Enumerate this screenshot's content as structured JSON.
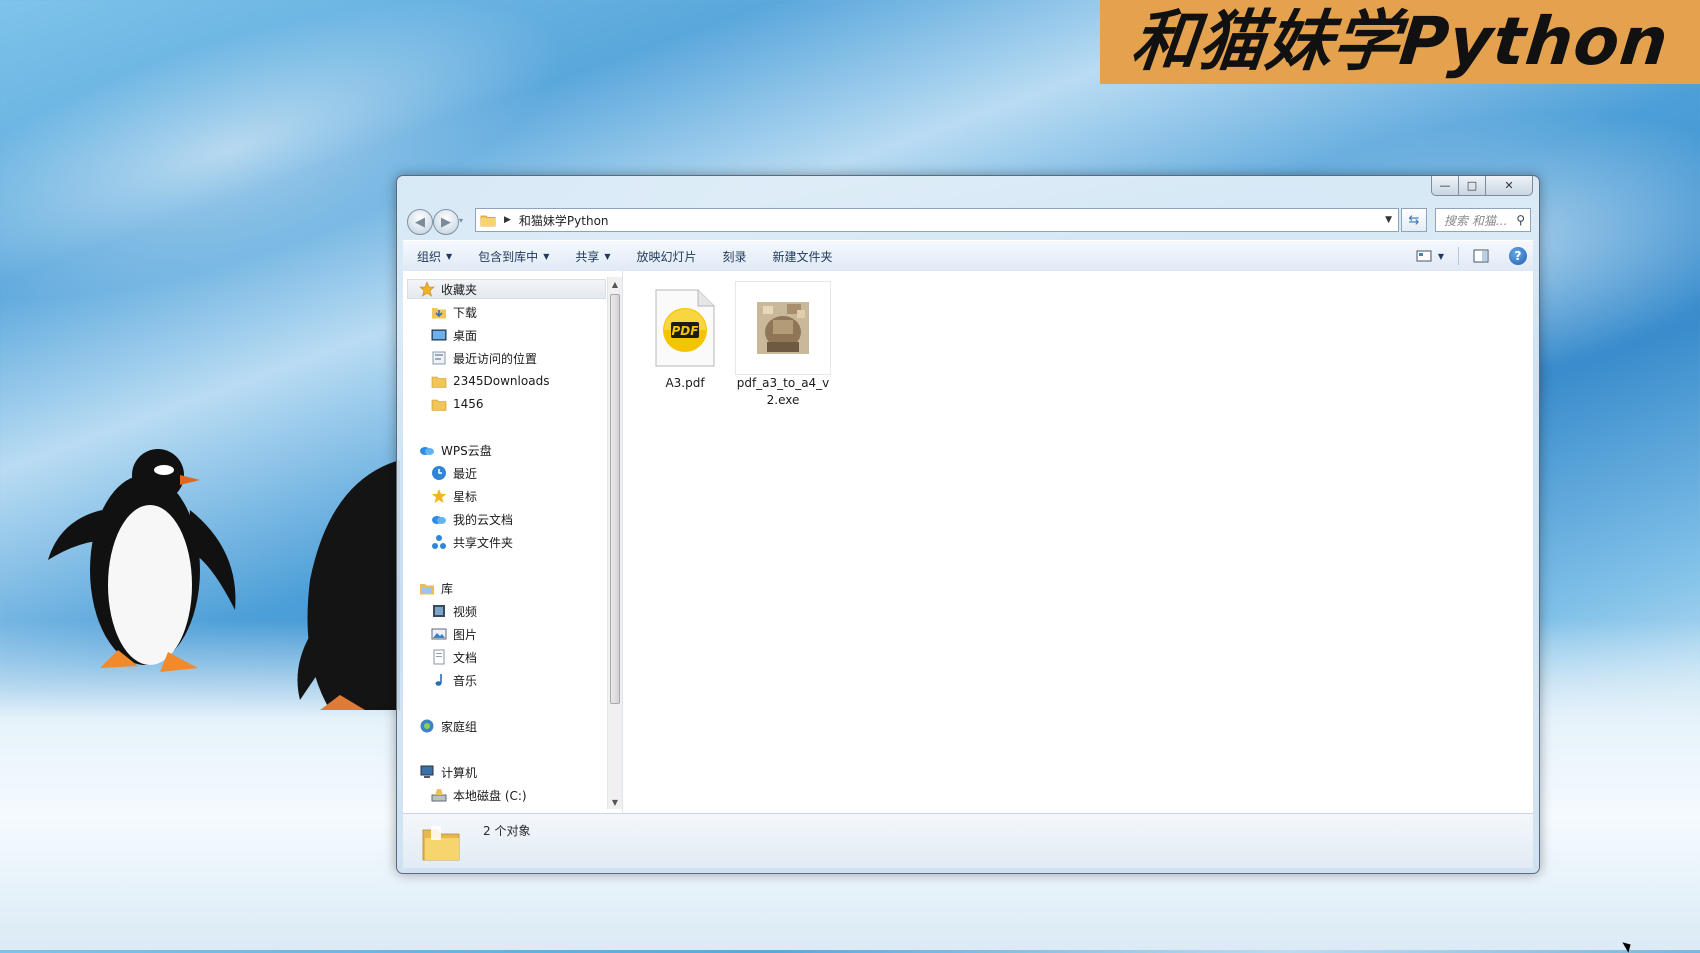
{
  "banner": {
    "text": "和猫妹学Python"
  },
  "window": {
    "caption_buttons": {
      "minimize": "—",
      "maximize": "□",
      "close": "✕"
    },
    "address": {
      "path": "和猫妹学Python"
    },
    "search": {
      "placeholder": "搜索 和猫..."
    },
    "toolbar": {
      "organize": "组织",
      "include_library": "包含到库中",
      "share": "共享",
      "slideshow": "放映幻灯片",
      "burn": "刻录",
      "new_folder": "新建文件夹"
    },
    "nav": {
      "favorites": {
        "label": "收藏夹",
        "items": [
          {
            "label": "下载",
            "icon": "download-folder-icon"
          },
          {
            "label": "桌面",
            "icon": "desktop-icon"
          },
          {
            "label": "最近访问的位置",
            "icon": "recent-places-icon"
          },
          {
            "label": "2345Downloads",
            "icon": "folder-icon"
          },
          {
            "label": "1456",
            "icon": "folder-icon"
          }
        ]
      },
      "wps": {
        "label": "WPS云盘",
        "items": [
          {
            "label": "最近",
            "icon": "clock-icon"
          },
          {
            "label": "星标",
            "icon": "star-icon"
          },
          {
            "label": "我的云文档",
            "icon": "cloud-icon"
          },
          {
            "label": "共享文件夹",
            "icon": "share-icon"
          }
        ]
      },
      "library": {
        "label": "库",
        "items": [
          {
            "label": "视频",
            "icon": "video-icon"
          },
          {
            "label": "图片",
            "icon": "pictures-icon"
          },
          {
            "label": "文档",
            "icon": "documents-icon"
          },
          {
            "label": "音乐",
            "icon": "music-icon"
          }
        ]
      },
      "homegroup": {
        "label": "家庭组"
      },
      "computer": {
        "label": "计算机",
        "items": [
          {
            "label": "本地磁盘 (C:)",
            "icon": "drive-icon"
          }
        ]
      }
    },
    "files": [
      {
        "name": "A3.pdf",
        "icon": "pdf-file-icon"
      },
      {
        "name": "pdf_a3_to_a4_v2.exe",
        "icon": "exe-file-icon"
      }
    ],
    "details": {
      "count": "2 个对象"
    }
  },
  "colors": {
    "banner": "#e5a24e",
    "toolbar_text": "#1e395b",
    "pdf_yellow": "#f5c400"
  }
}
